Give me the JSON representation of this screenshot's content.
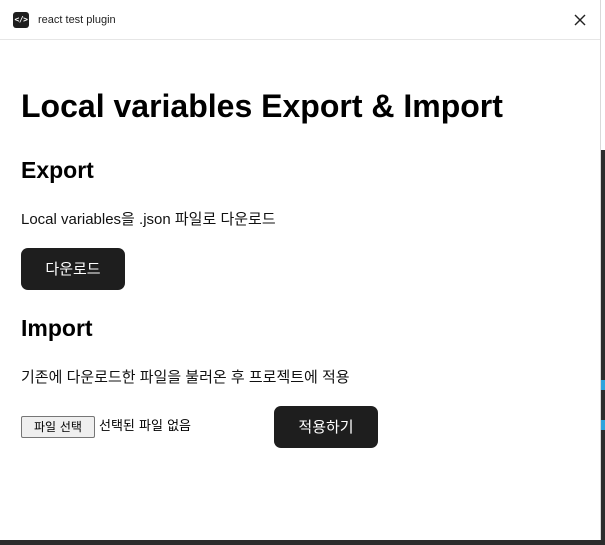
{
  "window": {
    "title": "react test plugin",
    "icon": "code-icon",
    "icon_glyph": "</>",
    "close_icon": "close-icon"
  },
  "page": {
    "title": "Local variables Export & Import"
  },
  "export": {
    "heading": "Export",
    "description": "Local variables을 .json 파일로 다운로드",
    "download_button": "다운로드"
  },
  "import": {
    "heading": "Import",
    "description": "기존에 다운로드한 파일을 불러온 후 프로젝트에 적용",
    "file_button": "파일 선택",
    "file_status": "선택된 파일 없음",
    "apply_button": "적용하기"
  },
  "colors": {
    "button_bg": "#1e1e1e",
    "button_text": "#ffffff",
    "accent": "#2ea3dd",
    "backdrop": "#2c2c2c"
  }
}
